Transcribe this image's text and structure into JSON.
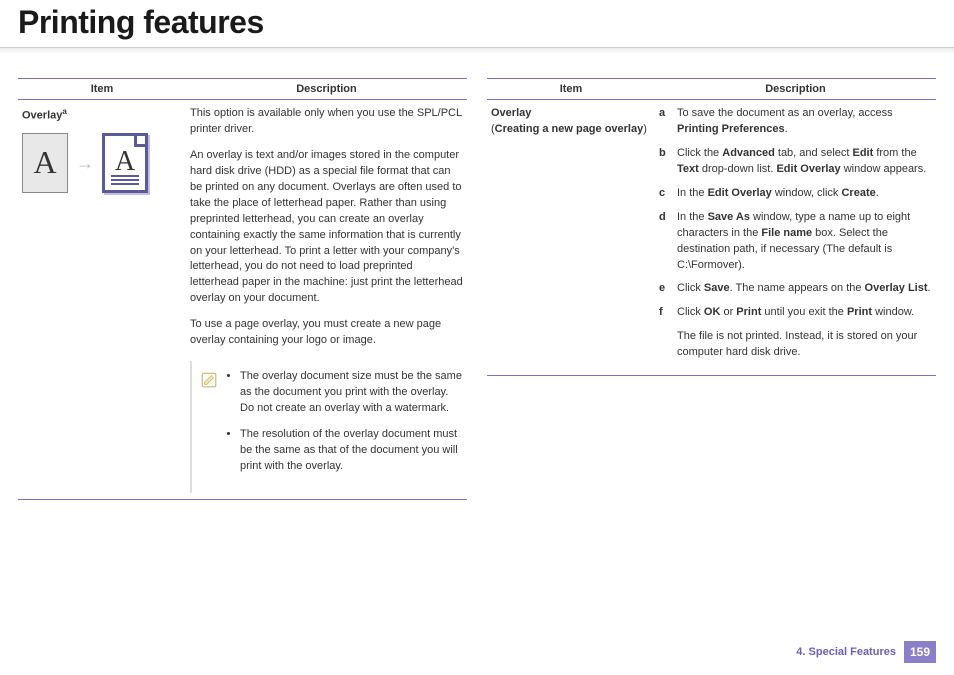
{
  "title": "Printing features",
  "footer": {
    "chapter": "4.  Special Features",
    "page": "159"
  },
  "headers": {
    "item": "Item",
    "desc": "Description"
  },
  "left": {
    "item_title": "Overlay",
    "item_sup": "a",
    "p1": "This option is available only when you use the SPL/PCL printer driver.",
    "p2": "An overlay is text and/or images stored in the computer hard disk drive (HDD) as a special file format that can be printed on any document. Overlays are often used to take the place of letterhead paper. Rather than using preprinted letterhead, you can create an overlay containing exactly the same information that is currently on your letterhead. To print a letter with your company's letterhead, you do not need to load preprinted letterhead paper in the machine: just print the letterhead overlay on your document.",
    "p3": "To use a page overlay, you must create a new page overlay containing your logo or image.",
    "notes": [
      "The overlay document size must be the same as the document you print with the overlay. Do not create an overlay with a watermark.",
      "The resolution of the overlay document must be the same as that of the document you will print with the overlay."
    ],
    "letterA1": "A",
    "letterA2": "A"
  },
  "right": {
    "item_title": "Overlay",
    "item_sub_open": "(",
    "item_sub_bold": "Creating a new page overlay",
    "item_sub_close": ")",
    "steps": {
      "a1": "To save the document as an overlay, access ",
      "a2": "Printing Preferences",
      "a3": ".",
      "b1": "Click the ",
      "b2": "Advanced",
      "b3": " tab, and select ",
      "b4": "Edit",
      "b5": " from the ",
      "b6": "Text",
      "b7": " drop-down list. ",
      "b8": "Edit Overlay",
      "b9": " window appears.",
      "c1": "In the ",
      "c2": "Edit Overlay",
      "c3": " window, click ",
      "c4": "Create",
      "c5": ".",
      "d1": "In the ",
      "d2": "Save As",
      "d3": " window, type a name up to eight characters in the ",
      "d4": "File name",
      "d5": " box. Select the destination path, if necessary (The default is C:\\Formover).",
      "e1": "Click ",
      "e2": "Save",
      "e3": ". The name appears on the ",
      "e4": "Overlay List",
      "e5": ".",
      "f1": "Click ",
      "f2": "OK",
      "f3": " or ",
      "f4": "Print",
      "f5": " until you exit the ",
      "f6": "Print",
      "f7": " window.",
      "g1": "The file is not printed. Instead, it is stored on your computer hard disk drive."
    }
  }
}
